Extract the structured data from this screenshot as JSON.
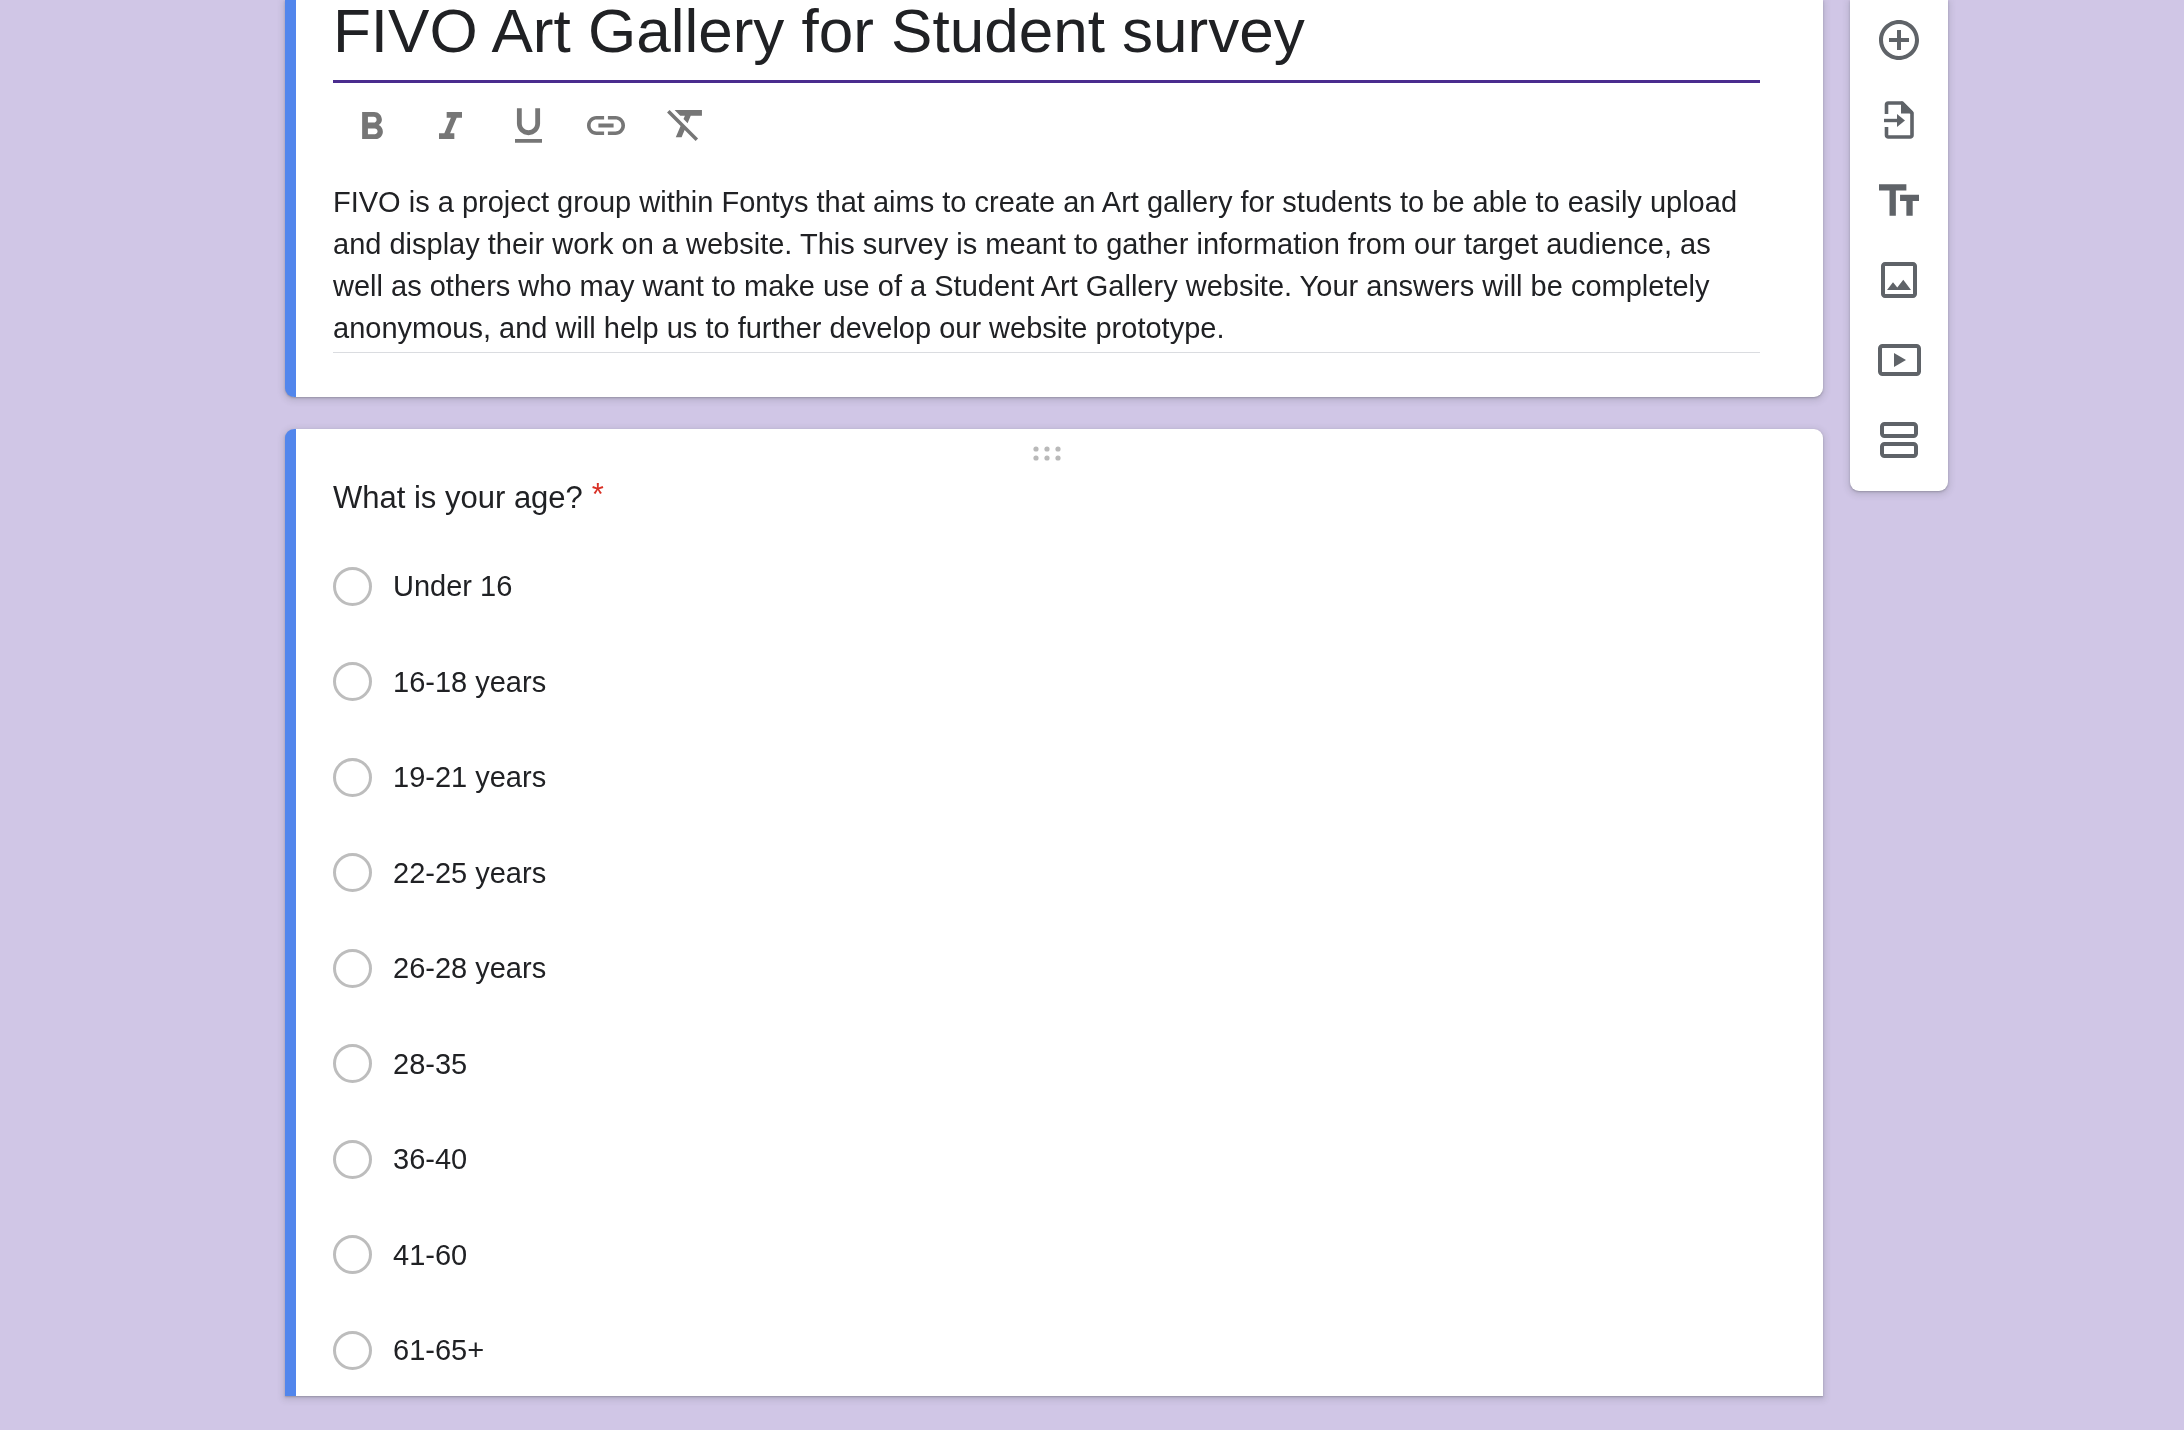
{
  "form_header": {
    "selected": true,
    "title": {
      "value": "FIVO Art Gallery for Student survey",
      "focused": true
    },
    "description": {
      "value": "FIVO is a project group within Fontys that aims to create an Art gallery for students to be able to easily upload and display their work on a website. This survey is meant to gather information from our target audience, as well as others who may want to make use of a Student Art Gallery website. Your answers will be completely anonymous, and will help us to further develop our website prototype.",
      "focused": false
    }
  },
  "questions": [
    {
      "selected": true,
      "title": "What is your age?",
      "required_marker": "*",
      "options": [
        {
          "label": "Under 16",
          "selected": false
        },
        {
          "label": "16-18 years",
          "selected": false
        },
        {
          "label": "19-21 years",
          "selected": false
        },
        {
          "label": "22-25 years",
          "selected": false
        },
        {
          "label": "26-28 years",
          "selected": false
        },
        {
          "label": "28-35",
          "selected": false
        },
        {
          "label": "36-40",
          "selected": false
        },
        {
          "label": "41-60",
          "selected": false
        },
        {
          "label": "61-65+",
          "selected": false
        }
      ]
    }
  ]
}
